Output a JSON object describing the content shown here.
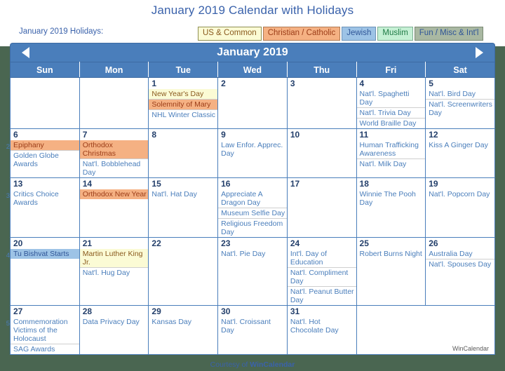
{
  "page": {
    "title": "January 2019 Calendar with Holidays",
    "holidays_label": "January 2019 Holidays:",
    "footer_prefix": "Courtesy of ",
    "footer_brand": "WinCalendar",
    "watermark": "WinCalendar",
    "background_color": "#4a6651",
    "accent_color": "#4a7ebb"
  },
  "legend": {
    "items": [
      {
        "label": "US & Common",
        "bg": "#fbfbd5",
        "fg": "#8a5a1e"
      },
      {
        "label": "Christian / Catholic",
        "bg": "#f5b183",
        "fg": "#9c3d18"
      },
      {
        "label": "Jewish",
        "bg": "#9dc3e6",
        "fg": "#2f5597"
      },
      {
        "label": "Muslim",
        "bg": "#c5f0d4",
        "fg": "#1f7a45"
      },
      {
        "label": "Fun / Misc & Int'l",
        "bg": "#a9b8a2",
        "fg": "#2f5597"
      }
    ]
  },
  "calendar": {
    "month_title": "January 2019",
    "prev_label": "Previous month",
    "next_label": "Next month",
    "weekday_headers": [
      "Sun",
      "Mon",
      "Tue",
      "Wed",
      "Thu",
      "Fri",
      "Sat"
    ],
    "week_numbers": [
      "2",
      "3",
      "4",
      "5"
    ],
    "weeks": [
      {
        "days": [
          {
            "num": "",
            "blank": true,
            "events": []
          },
          {
            "num": "",
            "blank": true,
            "events": []
          },
          {
            "num": "1",
            "events": [
              {
                "text": "New Year's Day",
                "type": "us"
              },
              {
                "text": "Solemnity of Mary",
                "type": "chr"
              },
              {
                "text": "NHL Winter Classic",
                "type": "fun"
              }
            ]
          },
          {
            "num": "2",
            "events": []
          },
          {
            "num": "3",
            "events": []
          },
          {
            "num": "4",
            "events": [
              {
                "text": "Nat'l. Spaghetti Day",
                "type": "fun"
              },
              {
                "text": "Nat'l. Trivia Day",
                "type": "fun"
              },
              {
                "text": "World Braille Day",
                "type": "fun"
              }
            ]
          },
          {
            "num": "5",
            "weekend": true,
            "events": [
              {
                "text": "Nat'l. Bird Day",
                "type": "fun"
              },
              {
                "text": "Nat'l. Screenwriters Day",
                "type": "fun"
              }
            ]
          }
        ]
      },
      {
        "days": [
          {
            "num": "6",
            "weekend": true,
            "events": [
              {
                "text": "Epiphany",
                "type": "chr"
              },
              {
                "text": "Golden Globe Awards",
                "type": "fun"
              }
            ]
          },
          {
            "num": "7",
            "events": [
              {
                "text": "Orthodox Christmas",
                "type": "chr"
              },
              {
                "text": "Nat'l. Bobblehead Day",
                "type": "fun"
              }
            ]
          },
          {
            "num": "8",
            "events": []
          },
          {
            "num": "9",
            "events": [
              {
                "text": "Law Enfor. Apprec. Day",
                "type": "fun"
              }
            ]
          },
          {
            "num": "10",
            "events": []
          },
          {
            "num": "11",
            "events": [
              {
                "text": "Human Trafficking Awareness",
                "type": "fun"
              },
              {
                "text": "Nat'l. Milk Day",
                "type": "fun"
              }
            ]
          },
          {
            "num": "12",
            "weekend": true,
            "events": [
              {
                "text": "Kiss A Ginger Day",
                "type": "fun"
              }
            ]
          }
        ]
      },
      {
        "days": [
          {
            "num": "13",
            "weekend": true,
            "events": [
              {
                "text": "Critics Choice Awards",
                "type": "fun"
              }
            ]
          },
          {
            "num": "14",
            "events": [
              {
                "text": "Orthodox New Year",
                "type": "chr"
              }
            ]
          },
          {
            "num": "15",
            "events": [
              {
                "text": "Nat'l. Hat Day",
                "type": "fun"
              }
            ]
          },
          {
            "num": "16",
            "events": [
              {
                "text": "Appreciate A Dragon Day",
                "type": "fun"
              },
              {
                "text": "Museum Selfie Day",
                "type": "fun"
              },
              {
                "text": "Religious Freedom Day",
                "type": "fun"
              }
            ]
          },
          {
            "num": "17",
            "events": []
          },
          {
            "num": "18",
            "events": [
              {
                "text": "Winnie The Pooh Day",
                "type": "fun"
              }
            ]
          },
          {
            "num": "19",
            "weekend": true,
            "events": [
              {
                "text": "Nat'l. Popcorn Day",
                "type": "fun"
              }
            ]
          }
        ]
      },
      {
        "days": [
          {
            "num": "20",
            "weekend": true,
            "events": [
              {
                "text": "Tu Bishvat Starts",
                "type": "jew"
              }
            ]
          },
          {
            "num": "21",
            "events": [
              {
                "text": "Martin Luther King Jr.",
                "type": "us"
              },
              {
                "text": "Nat'l. Hug Day",
                "type": "fun"
              }
            ]
          },
          {
            "num": "22",
            "events": []
          },
          {
            "num": "23",
            "events": [
              {
                "text": "Nat'l. Pie Day",
                "type": "fun"
              }
            ]
          },
          {
            "num": "24",
            "events": [
              {
                "text": "Int'l. Day of Education",
                "type": "fun"
              },
              {
                "text": "Nat'l. Compliment Day",
                "type": "fun"
              },
              {
                "text": "Nat'l. Peanut Butter Day",
                "type": "fun"
              }
            ]
          },
          {
            "num": "25",
            "events": [
              {
                "text": "Robert Burns Night",
                "type": "fun"
              }
            ]
          },
          {
            "num": "26",
            "weekend": true,
            "events": [
              {
                "text": "Australia Day",
                "type": "fun"
              },
              {
                "text": "Nat'l. Spouses Day",
                "type": "fun"
              }
            ]
          }
        ]
      },
      {
        "days": [
          {
            "num": "27",
            "weekend": true,
            "events": [
              {
                "text": "Commemoration Victims of the Holocaust",
                "type": "fun"
              },
              {
                "text": "SAG Awards",
                "type": "fun"
              }
            ]
          },
          {
            "num": "28",
            "events": [
              {
                "text": "Data Privacy Day",
                "type": "fun"
              }
            ]
          },
          {
            "num": "29",
            "events": [
              {
                "text": "Kansas Day",
                "type": "fun"
              }
            ]
          },
          {
            "num": "30",
            "events": [
              {
                "text": "Nat'l. Croissant Day",
                "type": "fun"
              }
            ]
          },
          {
            "num": "31",
            "events": [
              {
                "text": "Nat'l. Hot Chocolate Day",
                "type": "fun"
              }
            ]
          },
          {
            "num": "",
            "blank": true,
            "merged": true,
            "events": []
          }
        ]
      }
    ]
  }
}
